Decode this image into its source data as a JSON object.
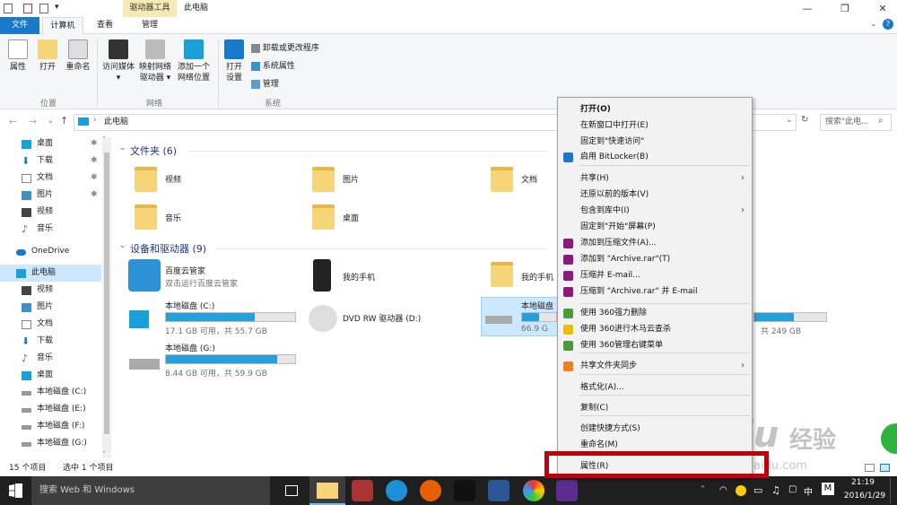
{
  "titlebar": {
    "context_tab": "驱动器工具",
    "title": "此电脑"
  },
  "tabs": {
    "file": "文件",
    "computer": "计算机",
    "view": "查看",
    "manage": "管理"
  },
  "ribbon": {
    "properties": "属性",
    "open": "打开",
    "rename": "重命名",
    "access_media": "访问媒体",
    "map_drive_1": "映射网络",
    "map_drive_2": "驱动器",
    "add_location_1": "添加一个",
    "add_location_2": "网络位置",
    "open_settings_1": "打开",
    "open_settings_2": "设置",
    "uninstall": "卸载或更改程序",
    "system_props": "系统属性",
    "manage": "管理",
    "group_location": "位置",
    "group_network": "网络",
    "group_system": "系统"
  },
  "address": {
    "path": "此电脑",
    "search_placeholder": "搜索\"此电..."
  },
  "nav": {
    "items": [
      "桌面",
      "下载",
      "文档",
      "图片",
      "视频",
      "音乐",
      "OneDrive",
      "此电脑",
      "视频",
      "图片",
      "文档",
      "下载",
      "音乐",
      "桌面",
      "本地磁盘 (C:)",
      "本地磁盘 (E:)",
      "本地磁盘 (F:)",
      "本地磁盘 (G:)"
    ]
  },
  "content": {
    "folders_header": "文件夹 (6)",
    "folders": [
      "视频",
      "图片",
      "文档",
      "音乐",
      "桌面"
    ],
    "devices_header": "设备和驱动器 (9)",
    "baidu_name": "百度云管家",
    "baidu_sub": "双击运行百度云管家",
    "phone": "我的手机",
    "phone2": "我的手机",
    "drive_c": "本地磁盘 (C:)",
    "drive_c_sub": "17.1 GB 可用，共 55.7 GB",
    "dvd": "DVD RW 驱动器 (D:)",
    "drive_sel": "本地磁盘",
    "drive_sel_sub": "66.9 G",
    "drive_g": "本地磁盘 (G:)",
    "drive_g_sub": "8.44 GB 可用，共 59.9 GB",
    "drive_right_sub": "共 249 GB"
  },
  "status": {
    "count": "15 个项目",
    "selected": "选中 1 个项目"
  },
  "taskbar": {
    "search": "搜索 Web 和 Windows",
    "time": "21:19",
    "date": "2016/1/29",
    "ime": "中",
    "ime2": "M"
  },
  "menu": {
    "items": [
      "打开(O)",
      "在新窗口中打开(E)",
      "固定到\"快速访问\"",
      "启用 BitLocker(B)",
      "共享(H)",
      "还原以前的版本(V)",
      "包含到库中(I)",
      "固定到\"开始\"屏幕(P)",
      "添加到压缩文件(A)...",
      "添加到 \"Archive.rar\"(T)",
      "压缩并 E-mail...",
      "压缩到 \"Archive.rar\" 并 E-mail",
      "使用 360强力删除",
      "使用 360进行木马云查杀",
      "使用 360管理右键菜单",
      "共享文件夹同步",
      "格式化(A)...",
      "复制(C)",
      "创建快捷方式(S)",
      "重命名(M)",
      "属性(R)"
    ]
  },
  "watermark": {
    "brand": "Baidu",
    "brand2": "经验",
    "url": "jingyan.baidu.com"
  },
  "colors": {
    "accent": "#1979ca",
    "highlight": "#c0000c",
    "bar": "#26a0da"
  },
  "drives": {
    "c_fraction": 0.69,
    "g_fraction": 0.86,
    "sel_fraction": 0.5
  }
}
